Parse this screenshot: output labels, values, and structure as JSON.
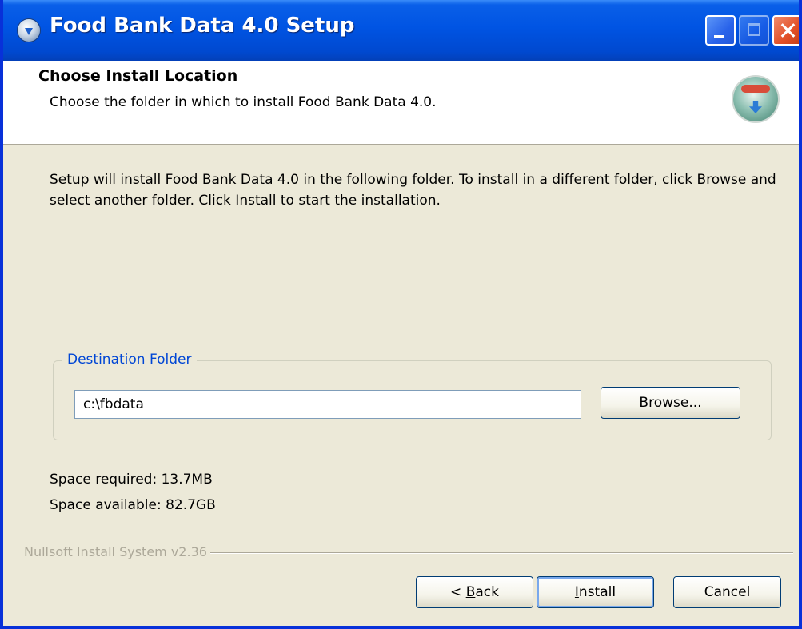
{
  "window": {
    "title": "Food Bank Data 4.0 Setup",
    "icon": "installer-disc-icon"
  },
  "header": {
    "title": "Choose Install Location",
    "subtitle": "Choose the folder in which to install Food Bank Data 4.0.",
    "icon": "install-location-icon"
  },
  "body": {
    "intro": "Setup will install Food Bank Data 4.0 in the following folder. To install in a different folder, click Browse and select another folder. Click Install to start the installation."
  },
  "destination": {
    "group_label": "Destination Folder",
    "path_value": "c:\\fbdata",
    "browse_pre": "B",
    "browse_mnemonic": "r",
    "browse_post": "owse..."
  },
  "space": {
    "required": "Space required: 13.7MB",
    "available": "Space available: 82.7GB"
  },
  "footer": {
    "branding": "Nullsoft Install System v2.36",
    "back_pre": "< ",
    "back_mnemonic": "B",
    "back_post": "ack",
    "install_mnemonic": "I",
    "install_post": "nstall",
    "cancel_label": "Cancel"
  },
  "colors": {
    "titlebar": "#0054e3",
    "dialog_bg": "#ece9d8",
    "group_label": "#0046d5",
    "branding": "#aca899"
  }
}
